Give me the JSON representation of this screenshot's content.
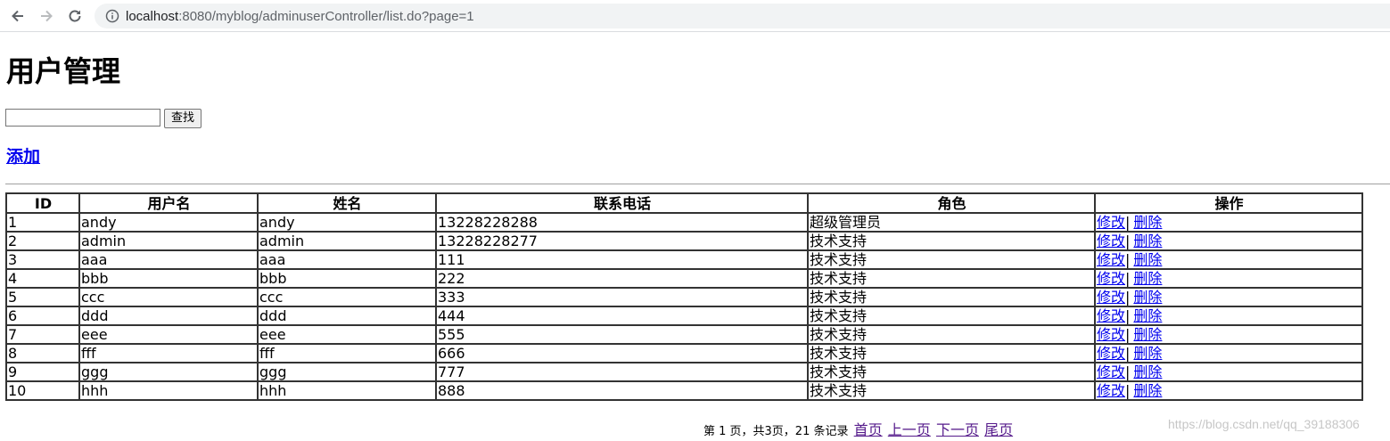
{
  "browser": {
    "url_host": "localhost",
    "url_rest": ":8080/myblog/adminuserController/list.do?page=1"
  },
  "page": {
    "title": "用户管理",
    "search": {
      "value": "",
      "placeholder": "",
      "button_label": "查找"
    },
    "add_link": "添加"
  },
  "table": {
    "headers": [
      "ID",
      "用户名",
      "姓名",
      "联系电话",
      "角色",
      "操作"
    ],
    "rows": [
      {
        "id": "1",
        "username": "andy",
        "name": "andy",
        "phone": "13228228288",
        "role": "超级管理员"
      },
      {
        "id": "2",
        "username": "admin",
        "name": "admin",
        "phone": "13228228277",
        "role": "技术支持"
      },
      {
        "id": "3",
        "username": "aaa",
        "name": "aaa",
        "phone": "111",
        "role": "技术支持"
      },
      {
        "id": "4",
        "username": "bbb",
        "name": "bbb",
        "phone": "222",
        "role": "技术支持"
      },
      {
        "id": "5",
        "username": "ccc",
        "name": "ccc",
        "phone": "333",
        "role": "技术支持"
      },
      {
        "id": "6",
        "username": "ddd",
        "name": "ddd",
        "phone": "444",
        "role": "技术支持"
      },
      {
        "id": "7",
        "username": "eee",
        "name": "eee",
        "phone": "555",
        "role": "技术支持"
      },
      {
        "id": "8",
        "username": "fff",
        "name": "fff",
        "phone": "666",
        "role": "技术支持"
      },
      {
        "id": "9",
        "username": "ggg",
        "name": "ggg",
        "phone": "777",
        "role": "技术支持"
      },
      {
        "id": "10",
        "username": "hhh",
        "name": "hhh",
        "phone": "888",
        "role": "技术支持"
      }
    ],
    "edit_label": "修改",
    "separator": "|",
    "delete_label": "删除"
  },
  "pager": {
    "summary": "第 1 页，共3页，21 条记录",
    "first": "首页",
    "prev": "上一页",
    "next": "下一页",
    "last": "尾页"
  },
  "watermark": "https://blog.csdn.net/qq_39188306"
}
